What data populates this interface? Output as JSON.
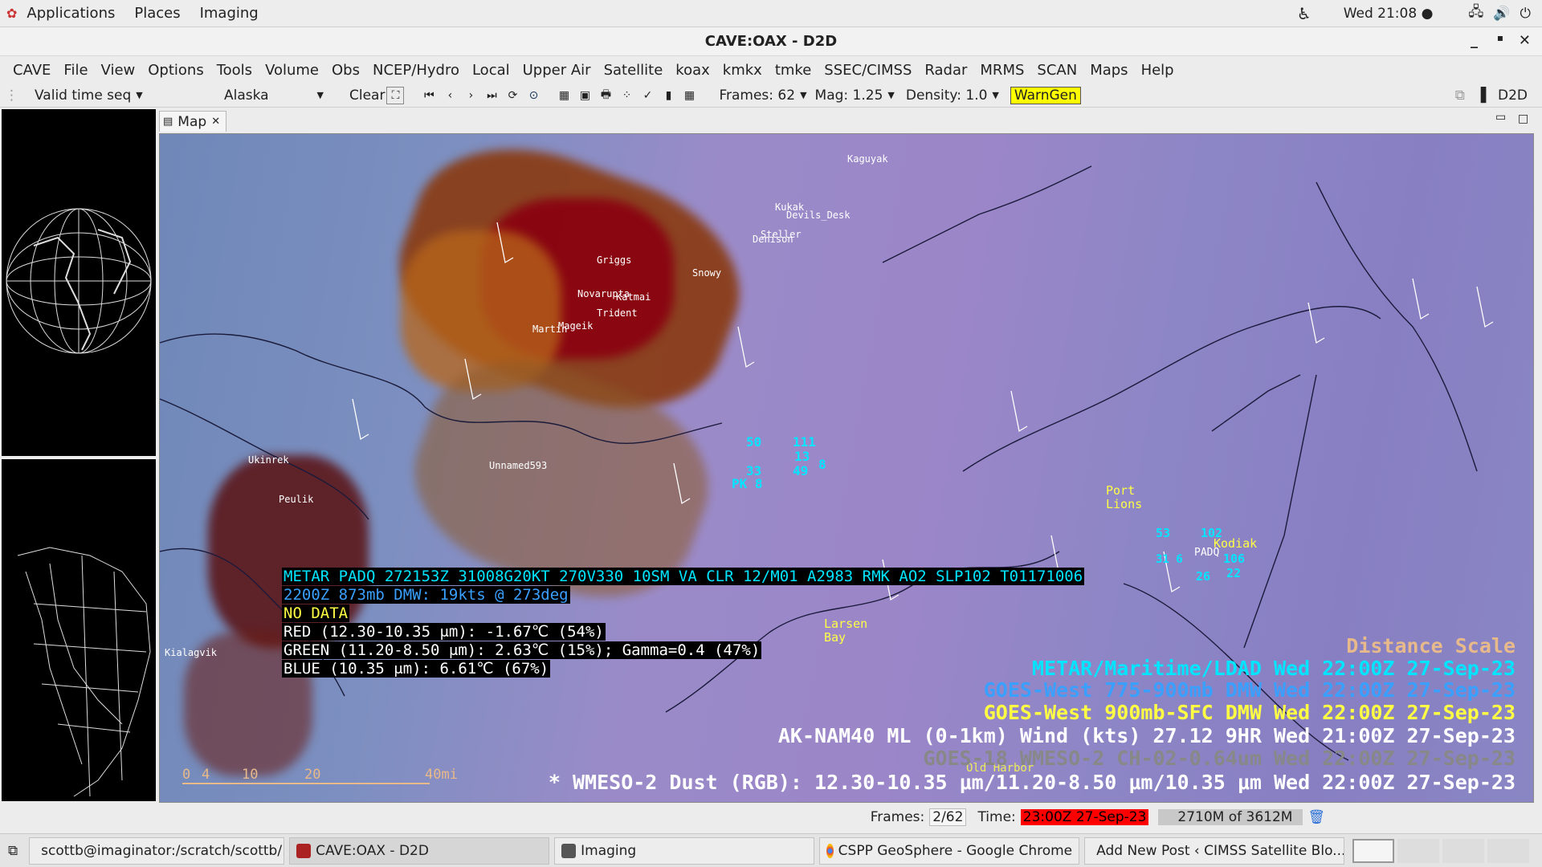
{
  "topbar": {
    "menus": [
      "Applications",
      "Places",
      "Imaging"
    ],
    "clock": "Wed 21:08 ●"
  },
  "window": {
    "title": "CAVE:OAX - D2D"
  },
  "menubar": [
    "CAVE",
    "File",
    "View",
    "Options",
    "Tools",
    "Volume",
    "Obs",
    "NCEP/Hydro",
    "Local",
    "Upper Air",
    "Satellite",
    "koax",
    "kmkx",
    "tmke",
    "SSEC/CIMSS",
    "Radar",
    "MRMS",
    "SCAN",
    "Maps",
    "Help"
  ],
  "toolbar": {
    "time_seq": "Valid time seq",
    "scale": "Alaska",
    "clear": "Clear",
    "frames": "Frames: 62",
    "mag": "Mag: 1.25",
    "density": "Density: 1.0",
    "warngen": "WarnGen",
    "perspective": "D2D"
  },
  "map": {
    "tab_label": "Map",
    "stations": [
      {
        "name": "Kaguyak"
      },
      {
        "name": "Kukak"
      },
      {
        "name": "Devils_Desk"
      },
      {
        "name": "Steller"
      },
      {
        "name": "Denison"
      },
      {
        "name": "Griggs"
      },
      {
        "name": "Snowy"
      },
      {
        "name": "Novarupta"
      },
      {
        "name": "Katmai"
      },
      {
        "name": "Trident"
      },
      {
        "name": "Martin"
      },
      {
        "name": "Mageik"
      },
      {
        "name": "Ukinrek"
      },
      {
        "name": "Peulik"
      },
      {
        "name": "Unnamed593"
      },
      {
        "name": "Kialagvik"
      }
    ],
    "places": {
      "port_lions": "Port Lions",
      "larsen_bay": "Larsen Bay",
      "kodiak": "Kodiak",
      "old_harbor": "Old Harbor",
      "padq": "PADQ"
    },
    "ob_values": {
      "a": "50",
      "b": "111",
      "c": "13",
      "d": "33",
      "e": "49",
      "f": "8",
      "g": "PK 8",
      "h": "53",
      "i": "102",
      "j": "106",
      "k": "22",
      "l": "26",
      "m": "31 6"
    },
    "sample": {
      "metar": "METAR PADQ 272153Z 31008G20KT 270V330 10SM VA CLR 12/M01 A2983 RMK AO2 SLP102 T01171006",
      "dmw": "2200Z 873mb DMW:  19kts @ 273deg",
      "nodata": "NO DATA",
      "red": "RED (12.30-10.35 μm): -1.67℃ (54%)",
      "green": "GREEN (11.20-8.50 μm): 2.63℃ (15%); Gamma=0.4 (47%)",
      "blue": "BLUE (10.35 μm): 6.61℃ (67%)"
    },
    "legend": {
      "distance": "Distance Scale",
      "metar": "METAR/Maritime/LDAD Wed 22:00Z 27-Sep-23",
      "goes_dmw_upper": "GOES-West 775-900mb DMW  Wed 22:00Z 27-Sep-23",
      "goes_dmw_lower": "GOES-West 900mb-SFC DMW  Wed 22:00Z 27-Sep-23",
      "nam": "AK-NAM40 ML (0-1km) Wind  (kts)    27.12   9HR Wed 21:00Z 27-Sep-23",
      "goes18": "GOES-18 WMESO-2 CH-02-0.64um      Wed 22:00Z 27-Sep-23",
      "dust": "* WMESO-2 Dust (RGB): 12.30-10.35 μm/11.20-8.50 μm/10.35 μm Wed 22:00Z 27-Sep-23"
    },
    "scale_labels": [
      "0",
      "4",
      "10",
      "20",
      "40mi"
    ]
  },
  "status": {
    "frames_label": "Frames:",
    "frames_value": "2/62",
    "time_label": "Time:",
    "time_value": "23:00Z 27-Sep-23",
    "memory": "2710M of 3612M"
  },
  "taskbar": [
    {
      "label": "scottb@imaginator:/scratch/scottb/..."
    },
    {
      "label": "CAVE:OAX - D2D"
    },
    {
      "label": "Imaging"
    },
    {
      "label": "CSPP GeoSphere - Google Chrome"
    },
    {
      "label": "Add New Post ‹ CIMSS Satellite Blo..."
    }
  ],
  "colors": {
    "warngen_bg": "#ffff00",
    "time_bg": "#ff0000",
    "cyan": "#00e5ff",
    "blue_legend": "#3aa0ff",
    "yellow_legend": "#ffff44",
    "distance_scale": "#e8b98a"
  }
}
